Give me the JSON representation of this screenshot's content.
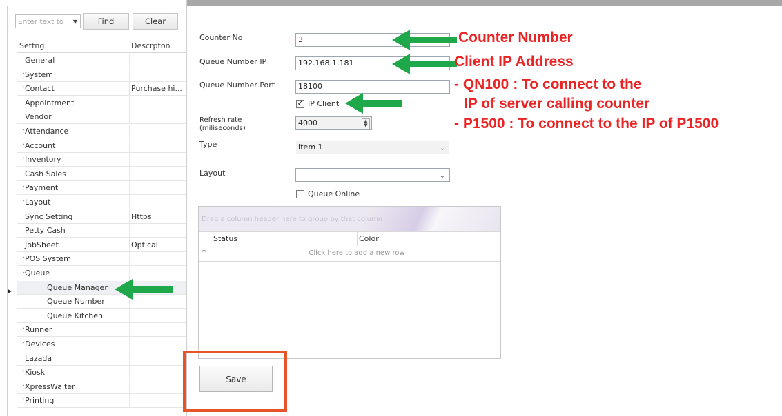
{
  "search": {
    "placeholder": "Enter text to",
    "find_label": "Find",
    "clear_label": "Clear"
  },
  "settings_table": {
    "columns": [
      "Settng",
      "Descrpton"
    ],
    "rows": [
      {
        "label": "General",
        "desc": "",
        "expandable": false,
        "indent": 0
      },
      {
        "label": "System",
        "desc": "",
        "expandable": true,
        "indent": 0
      },
      {
        "label": "Contact",
        "desc": "Purchase hi...",
        "expandable": true,
        "indent": 0
      },
      {
        "label": "Appointment",
        "desc": "",
        "expandable": false,
        "indent": 0
      },
      {
        "label": "Vendor",
        "desc": "",
        "expandable": false,
        "indent": 0
      },
      {
        "label": "Attendance",
        "desc": "",
        "expandable": true,
        "indent": 0
      },
      {
        "label": "Account",
        "desc": "",
        "expandable": true,
        "indent": 0
      },
      {
        "label": "Inventory",
        "desc": "",
        "expandable": true,
        "indent": 0
      },
      {
        "label": "Cash Sales",
        "desc": "",
        "expandable": false,
        "indent": 0
      },
      {
        "label": "Payment",
        "desc": "",
        "expandable": true,
        "indent": 0
      },
      {
        "label": "Layout",
        "desc": "",
        "expandable": true,
        "indent": 0
      },
      {
        "label": "Sync Setting",
        "desc": "Https",
        "expandable": false,
        "indent": 0
      },
      {
        "label": "Petty Cash",
        "desc": "",
        "expandable": false,
        "indent": 0
      },
      {
        "label": "JobSheet",
        "desc": "Optical",
        "expandable": false,
        "indent": 0
      },
      {
        "label": "POS System",
        "desc": "",
        "expandable": true,
        "indent": 0
      },
      {
        "label": "Queue",
        "desc": "",
        "expandable": true,
        "expanded": true,
        "indent": 0
      },
      {
        "label": "Queue Manager",
        "desc": "",
        "expandable": false,
        "indent": 1,
        "selected": true
      },
      {
        "label": "Queue Number",
        "desc": "",
        "expandable": false,
        "indent": 1
      },
      {
        "label": "Queue Kitchen",
        "desc": "",
        "expandable": false,
        "indent": 1
      },
      {
        "label": "Runner",
        "desc": "",
        "expandable": true,
        "indent": 0
      },
      {
        "label": "Devices",
        "desc": "",
        "expandable": true,
        "indent": 0
      },
      {
        "label": "Lazada",
        "desc": "",
        "expandable": false,
        "indent": 0
      },
      {
        "label": "Kiosk",
        "desc": "",
        "expandable": true,
        "indent": 0
      },
      {
        "label": "XpressWaiter",
        "desc": "",
        "expandable": true,
        "indent": 0
      },
      {
        "label": "Printing",
        "desc": "",
        "expandable": true,
        "indent": 0
      }
    ]
  },
  "form": {
    "counter_no_label": "Counter No",
    "counter_no_value": "3",
    "qn_ip_label": "Queue Number IP",
    "qn_ip_value": "192.168.1.181",
    "qn_port_label": "Queue Number Port",
    "qn_port_value": "18100",
    "ip_client_label": "IP Client",
    "ip_client_checked": true,
    "refresh_label_1": "Refresh rate",
    "refresh_label_2": "(miliseconds)",
    "refresh_value": "4000",
    "type_label": "Type",
    "type_value": "Item 1",
    "layout_label": "Layout",
    "layout_value": "",
    "queue_online_label": "Queue Online",
    "queue_online_checked": false
  },
  "grid": {
    "group_hint": "Drag a column header here to group by that column",
    "columns": [
      "Status",
      "Color"
    ],
    "new_row_marker": "*",
    "new_row_hint": "Click here to add a new row"
  },
  "save_label": "Save",
  "annotations": {
    "counter_number": "Counter Number",
    "client_ip": "Client IP Address",
    "qn100_line1": "- QN100 : To connect to the",
    "qn100_line2": "IP of server calling counter",
    "p1500_line": "- P1500 : To connect to the IP of P1500"
  },
  "colors": {
    "arrow": "#1fa84a",
    "annotation_text": "#ea2424",
    "highlight_box": "#e8542a"
  }
}
